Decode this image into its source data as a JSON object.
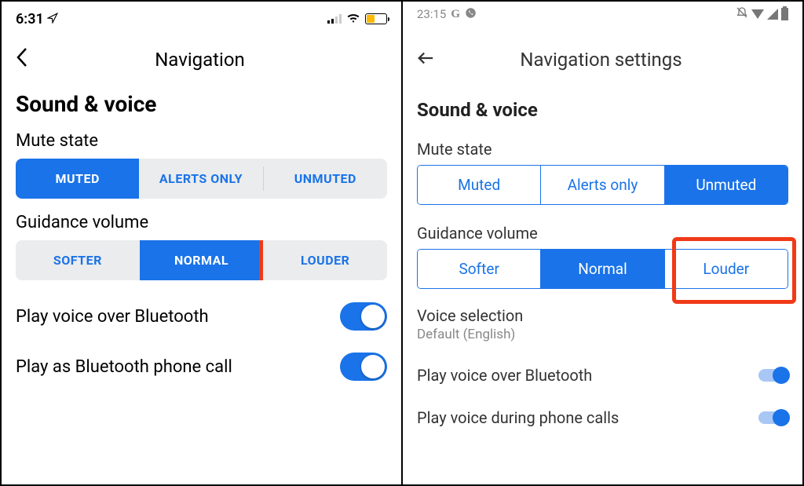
{
  "left": {
    "status": {
      "time": "6:31"
    },
    "header": {
      "title": "Navigation"
    },
    "section": "Sound & voice",
    "mute": {
      "label": "Mute state",
      "options": [
        "MUTED",
        "ALERTS ONLY",
        "UNMUTED"
      ],
      "selected": "MUTED"
    },
    "guidance": {
      "label": "Guidance volume",
      "options": [
        "SOFTER",
        "NORMAL",
        "LOUDER"
      ],
      "selected": "NORMAL",
      "highlighted": "LOUDER"
    },
    "rows": {
      "bluetooth": {
        "label": "Play voice over Bluetooth",
        "value": true
      },
      "phonecall": {
        "label": "Play as Bluetooth phone call",
        "value": true
      }
    }
  },
  "right": {
    "status": {
      "time": "23:15"
    },
    "header": {
      "title": "Navigation settings"
    },
    "section": "Sound & voice",
    "mute": {
      "label": "Mute state",
      "options": [
        "Muted",
        "Alerts only",
        "Unmuted"
      ],
      "selected": "Unmuted"
    },
    "guidance": {
      "label": "Guidance volume",
      "options": [
        "Softer",
        "Normal",
        "Louder"
      ],
      "selected": "Normal",
      "highlighted": "Louder"
    },
    "voice": {
      "label": "Voice selection",
      "value": "Default (English)"
    },
    "rows": {
      "bluetooth": {
        "label": "Play voice over Bluetooth",
        "value": true
      },
      "phonecalls": {
        "label": "Play voice during phone calls",
        "value": true
      }
    }
  }
}
